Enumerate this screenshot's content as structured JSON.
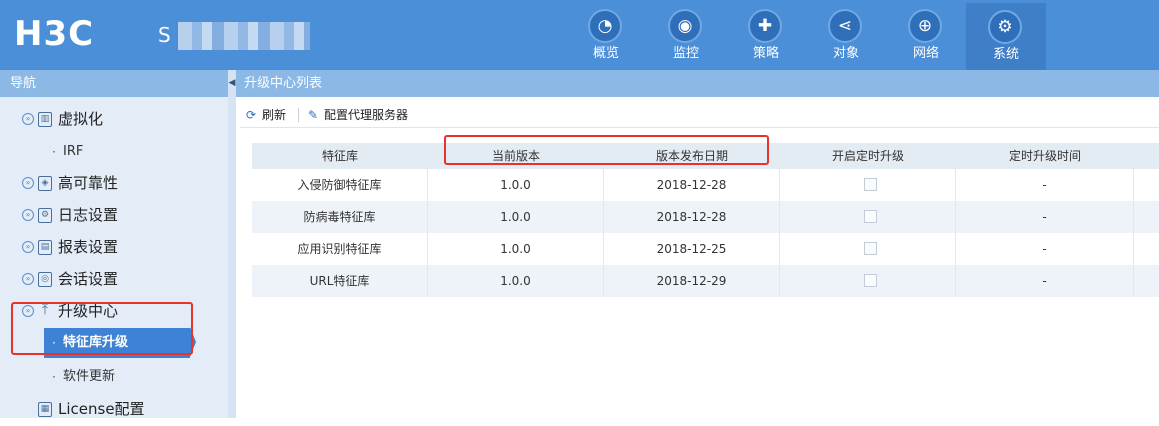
{
  "header": {
    "logo": "H3C",
    "device_name": "S",
    "nav": [
      {
        "label": "概览",
        "icon": "dashboard-icon",
        "glyph": "◔"
      },
      {
        "label": "监控",
        "icon": "camera-icon",
        "glyph": "◉"
      },
      {
        "label": "策略",
        "icon": "shield-plus-icon",
        "glyph": "✚"
      },
      {
        "label": "对象",
        "icon": "share-icon",
        "glyph": "⋖"
      },
      {
        "label": "网络",
        "icon": "globe-icon",
        "glyph": "⊕"
      },
      {
        "label": "系统",
        "icon": "monitor-gear-icon",
        "glyph": "⚙",
        "active": true
      }
    ]
  },
  "leftnav": {
    "title": "导航",
    "items": [
      {
        "label": "虚拟化",
        "icon": "virtualization-icon"
      },
      {
        "label": "IRF",
        "sub": true
      },
      {
        "label": "高可靠性",
        "icon": "reliability-shield-icon"
      },
      {
        "label": "日志设置",
        "icon": "log-settings-icon"
      },
      {
        "label": "报表设置",
        "icon": "report-settings-icon"
      },
      {
        "label": "会话设置",
        "icon": "session-settings-icon"
      },
      {
        "label": "升级中心",
        "icon": "upload-icon"
      },
      {
        "label": "特征库升级",
        "sub": true,
        "active": true
      },
      {
        "label": "软件更新",
        "sub": true
      },
      {
        "label": "License配置",
        "icon": "license-icon"
      }
    ]
  },
  "main": {
    "title": "升级中心列表",
    "toolbar": {
      "refresh": "刷新",
      "proxy": "配置代理服务器"
    },
    "table": {
      "headers": [
        "特征库",
        "当前版本",
        "版本发布日期",
        "开启定时升级",
        "定时升级时间"
      ],
      "rows": [
        {
          "name": "入侵防御特征库",
          "version": "1.0.0",
          "date": "2018-12-28",
          "scheduled": false,
          "time": "-"
        },
        {
          "name": "防病毒特征库",
          "version": "1.0.0",
          "date": "2018-12-28",
          "scheduled": false,
          "time": "-"
        },
        {
          "name": "应用识别特征库",
          "version": "1.0.0",
          "date": "2018-12-25",
          "scheduled": false,
          "time": "-"
        },
        {
          "name": "URL特征库",
          "version": "1.0.0",
          "date": "2018-12-29",
          "scheduled": false,
          "time": "-"
        }
      ]
    }
  },
  "colors": {
    "header_bg": "#4a8fd8",
    "title_bar": "#8cb8e6",
    "active_nav": "#3d82d4",
    "highlight": "#e8322b"
  }
}
